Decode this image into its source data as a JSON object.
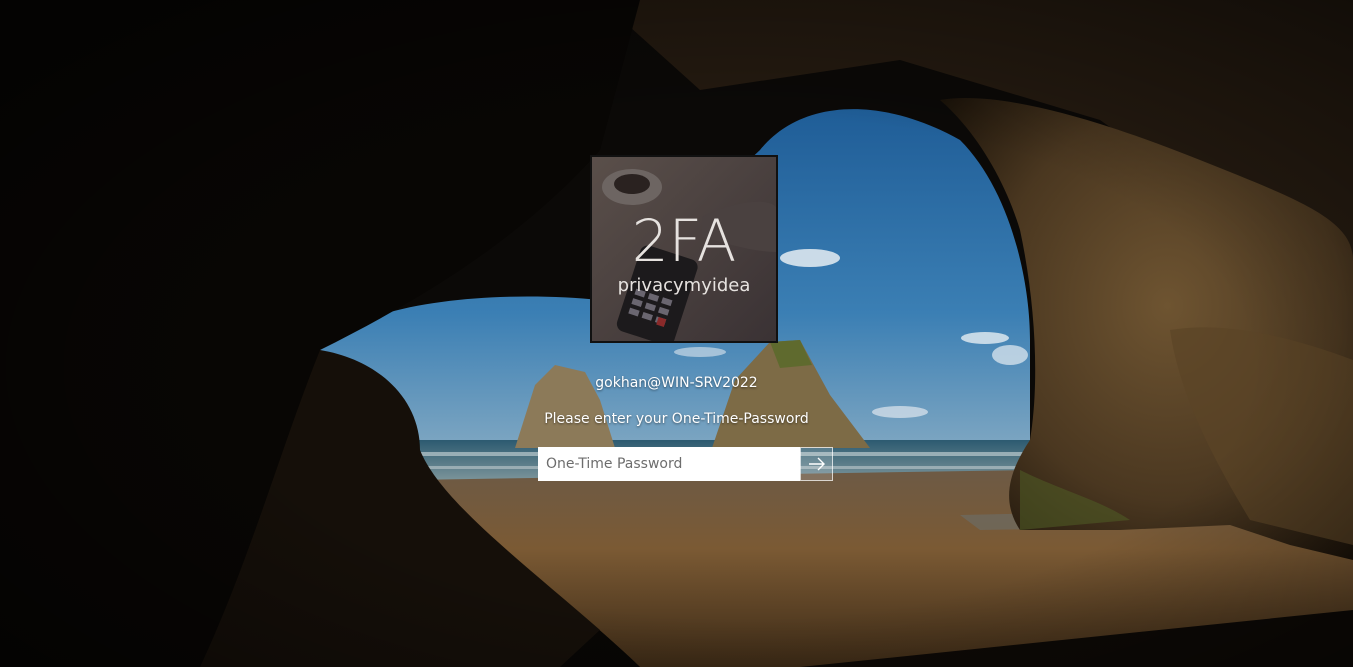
{
  "logo": {
    "big_text": "2FA",
    "sub_text": "privacymyidea"
  },
  "login": {
    "username": "gokhan@WIN-SRV2022",
    "prompt": "Please enter your One-Time-Password",
    "otp_placeholder": "One-Time Password",
    "otp_value": ""
  },
  "icons": {
    "submit": "arrow-right-icon"
  },
  "colors": {
    "text": "#ffffff",
    "input_bg": "#ffffff",
    "sky": "#2f6fa8",
    "sand": "#7a5a36",
    "cave": "#0b0907"
  }
}
